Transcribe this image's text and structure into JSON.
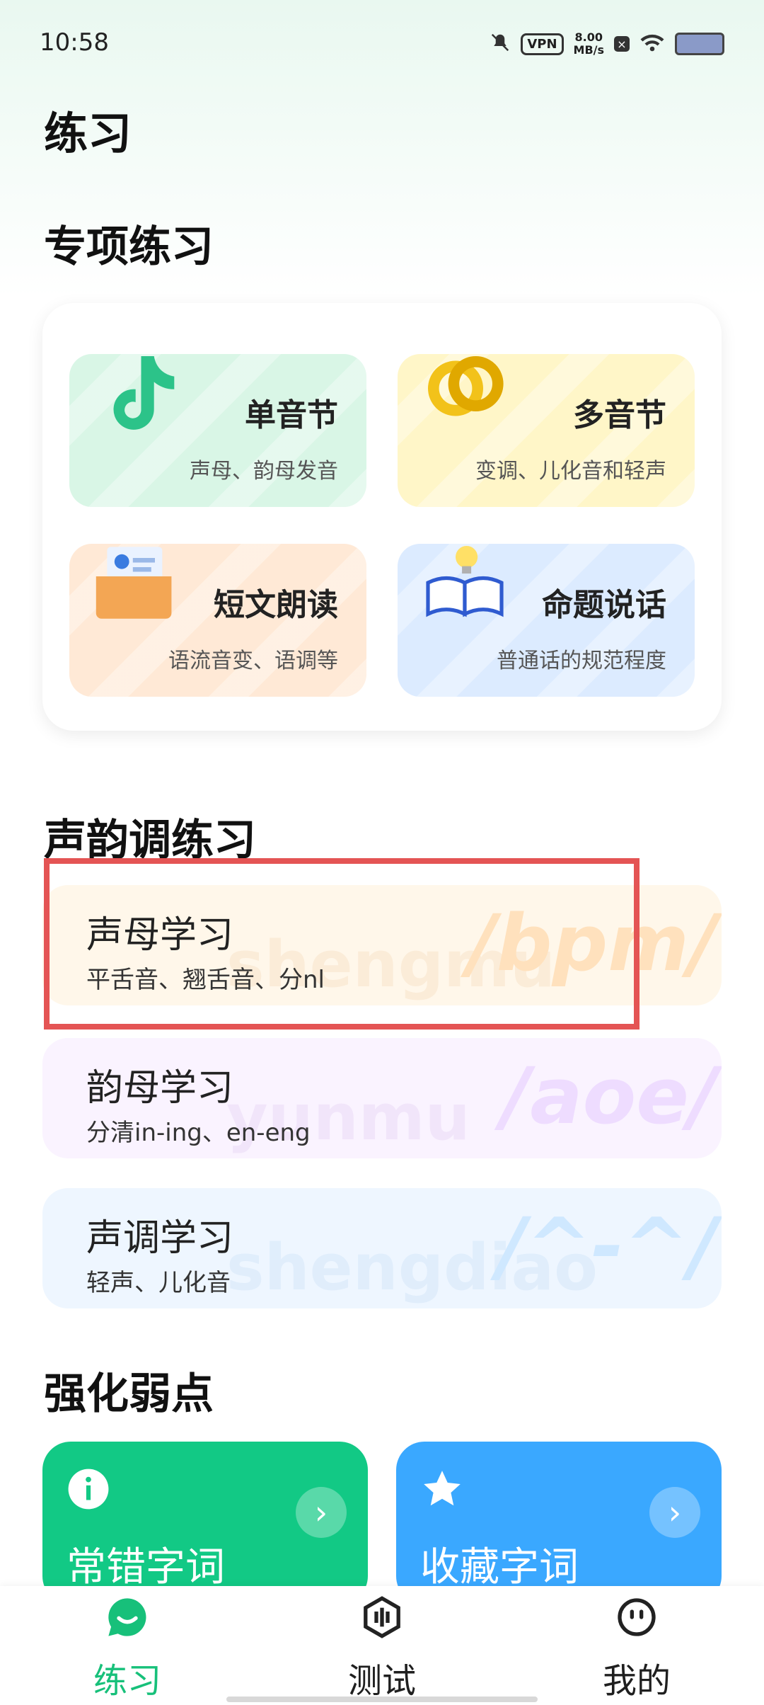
{
  "status_bar": {
    "time": "10:58",
    "vpn": "VPN",
    "speed_value": "8.00",
    "speed_unit": "MB/s"
  },
  "page": {
    "title": "练习"
  },
  "special_practice": {
    "section_title": "专项练习",
    "tiles": [
      {
        "title": "单音节",
        "subtitle": "声母、韵母发音",
        "icon": "music-note-icon",
        "bg": "#d9f6e6"
      },
      {
        "title": "多音节",
        "subtitle": "变调、儿化音和轻声",
        "icon": "ring-links-icon",
        "bg": "#fff6c8"
      },
      {
        "title": "短文朗读",
        "subtitle": "语流音变、语调等",
        "icon": "envelope-icon",
        "bg": "#ffe9d6"
      },
      {
        "title": "命题说话",
        "subtitle": "普通话的规范程度",
        "icon": "book-bulb-icon",
        "bg": "#dcebff"
      }
    ]
  },
  "tone_practice": {
    "section_title": "声韵调练习",
    "items": [
      {
        "title": "声母学习",
        "subtitle": "平舌音、翘舌音、分nl",
        "watermark": "/bpm/",
        "ghost": "shengmu",
        "bg": "#fff7ea",
        "accent": "#ffe1bd"
      },
      {
        "title": "韵母学习",
        "subtitle": "分清in-ing、en-eng",
        "watermark": "/aoe/",
        "ghost": "yunmu",
        "bg": "#faf3ff",
        "accent": "#eedcff"
      },
      {
        "title": "声调学习",
        "subtitle": "轻声、儿化音",
        "watermark": "/^-^/",
        "ghost": "shengdiao",
        "bg": "#eef6ff",
        "accent": "#cfe8ff"
      }
    ]
  },
  "weak_points": {
    "section_title": "强化弱点",
    "cards": [
      {
        "label": "常错字词",
        "icon": "info-icon",
        "color": "#12c985"
      },
      {
        "label": "收藏字词",
        "icon": "star-icon",
        "color": "#3aa8ff"
      }
    ]
  },
  "bottom_nav": {
    "items": [
      {
        "label": "练习",
        "icon": "chat-smile-icon",
        "active": true
      },
      {
        "label": "测试",
        "icon": "test-hex-icon",
        "active": false
      },
      {
        "label": "我的",
        "icon": "profile-face-icon",
        "active": false
      }
    ],
    "active_color": "#17c07a"
  }
}
